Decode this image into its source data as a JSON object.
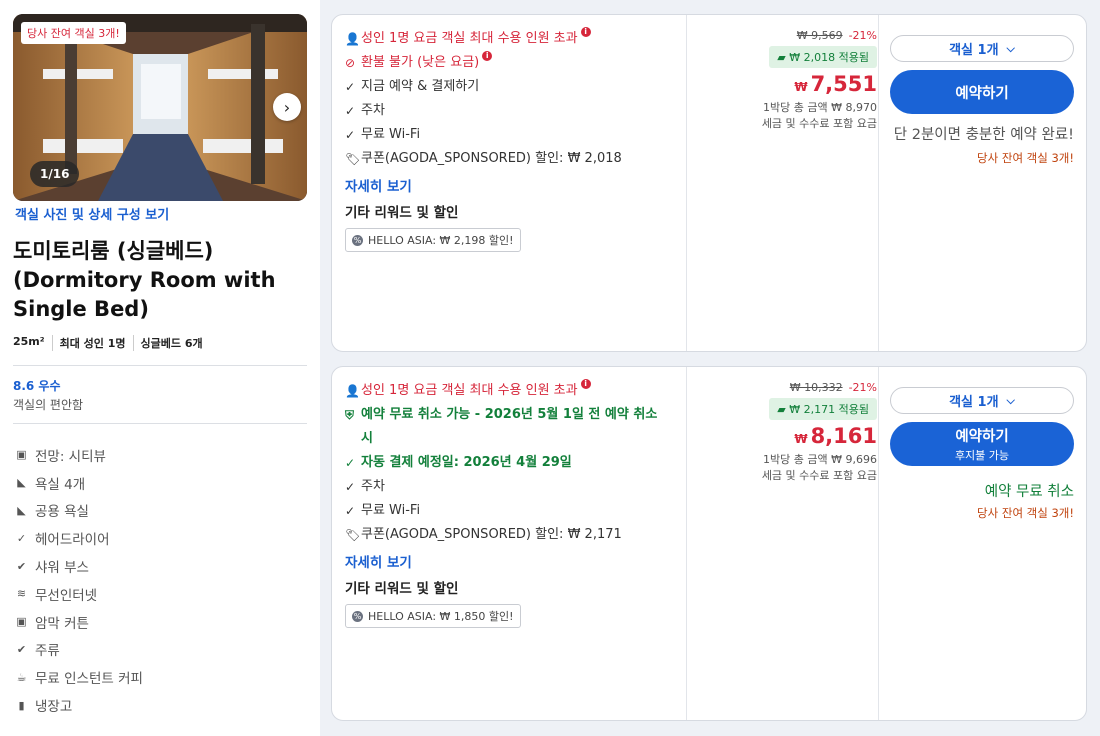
{
  "photo": {
    "badge": "당사 잔여 객실 3개!",
    "counter": "1/16",
    "link": "객실 사진 및 상세 구성 보기"
  },
  "room": {
    "title": "도미토리룸 (싱글베드) (Dormitory Room with Single Bed)",
    "meta": [
      "25m²",
      "최대 성인 1명",
      "싱글베드 6개"
    ],
    "score": "8.6 우수",
    "score_sub": "객실의 편안함"
  },
  "amenities": [
    {
      "icon": "view-icon",
      "label": "전망: 시티뷰"
    },
    {
      "icon": "bath-icon",
      "label": "욕실 4개"
    },
    {
      "icon": "bath-icon",
      "label": "공용 욕실"
    },
    {
      "icon": "check-icon",
      "label": "헤어드라이어"
    },
    {
      "icon": "check-circle-icon",
      "label": "샤워 부스"
    },
    {
      "icon": "wifi-icon",
      "label": "무선인터넷"
    },
    {
      "icon": "view-icon",
      "label": "암막 커튼"
    },
    {
      "icon": "check-circle-icon",
      "label": "주류"
    },
    {
      "icon": "coffee-icon",
      "label": "무료 인스턴트 커피"
    },
    {
      "icon": "fridge-icon",
      "label": "냉장고"
    }
  ],
  "offers": [
    {
      "occupancy": "성인 1명 요금 객실 최대 수용 인원 초과",
      "policy": "환불 불가 (낮은 요금)",
      "lines": [
        "지금 예약 & 결제하기",
        "주차",
        "무료 Wi-Fi"
      ],
      "coupon": "쿠폰(AGODA_SPONSORED) 할인: ₩ 2,018",
      "more": "자세히 보기",
      "rewards_title": "기타 리워드 및 할인",
      "rewards_chip": "HELLO ASIA: ₩ 2,198 할인!",
      "orig_price": "₩ 9,569",
      "discount": "-21%",
      "applied": "₩ 2,018 적용됨",
      "currency": "₩",
      "final_price": "7,551",
      "total": "1박당 총 금액 ₩ 8,970",
      "tax": "세금 및 수수료 포함 요금",
      "qty": "객실 1개",
      "book": "예약하기",
      "note": "단 2분이면 충분한 예약 완료!",
      "left": "당사 잔여 객실 3개!"
    },
    {
      "occupancy": "성인 1명 요금 객실 최대 수용 인원 초과",
      "policy": "예약 무료 취소 가능 - 2026년 5월 1일 전 예약 취소 시",
      "autopay": "자동 결제 예정일: 2026년 4월 29일",
      "lines": [
        "주차",
        "무료 Wi-Fi"
      ],
      "coupon": "쿠폰(AGODA_SPONSORED) 할인: ₩ 2,171",
      "more": "자세히 보기",
      "rewards_title": "기타 리워드 및 할인",
      "rewards_chip": "HELLO ASIA: ₩ 1,850 할인!",
      "orig_price": "₩ 10,332",
      "discount": "-21%",
      "applied": "₩ 2,171 적용됨",
      "currency": "₩",
      "final_price": "8,161",
      "total": "1박당 총 금액 ₩ 9,696",
      "tax": "세금 및 수수료 포함 요금",
      "qty": "객실 1개",
      "book": "예약하기",
      "book_sub": "후지불 가능",
      "note": "예약 무료 취소",
      "left": "당사 잔여 객실 3개!"
    }
  ],
  "colors": {
    "accent": "#1a63d6",
    "price": "#d6263a",
    "green": "#13803b"
  }
}
